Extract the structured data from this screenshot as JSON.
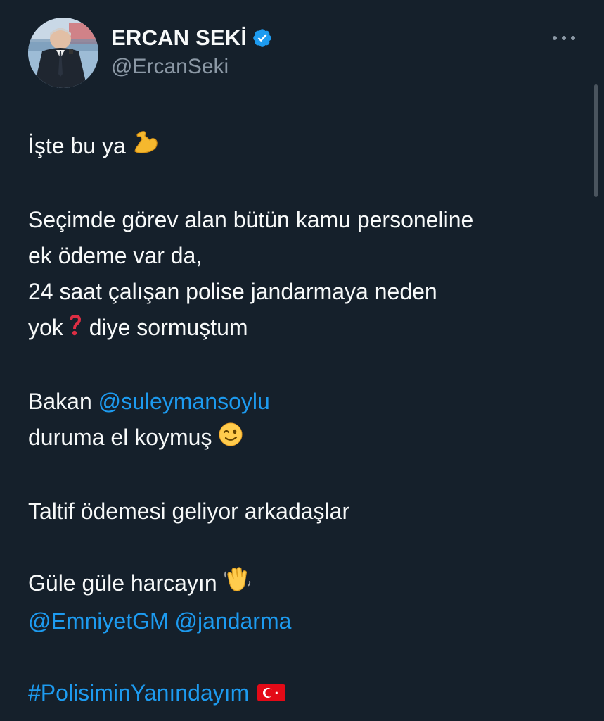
{
  "author": {
    "display_name": "ERCAN SEKİ",
    "handle": "@ErcanSeki",
    "verified": true
  },
  "tweet": {
    "line1_text": "İşte bu ya ",
    "line2": "Seçimde görev alan bütün kamu personeline",
    "line3": "ek ödeme var da,",
    "line4": "24 saat çalışan polise jandarmaya neden",
    "line5_before": "yok",
    "line5_after": " diye sormuştum",
    "line6_text": "Bakan ",
    "mention1": "@suleymansoylu",
    "line7_text": "duruma el koymuş ",
    "line8": "Taltif ödemesi geliyor arkadaşlar",
    "line9_text": "Güle güle harcayın ",
    "mention2": "@EmniyetGM",
    "mention3": "@jandarma",
    "hashtag": "#PolisiminYanındayım"
  },
  "icons": {
    "more": "more-options-icon",
    "verified": "verified-badge-icon",
    "emoji_muscle": "flexed-biceps-emoji",
    "emoji_question": "red-question-mark-emoji",
    "emoji_wink": "winking-face-emoji",
    "emoji_wave": "waving-hand-emoji",
    "emoji_flag": "turkey-flag-emoji"
  },
  "colors": {
    "background": "#15202b",
    "text": "#f7f9f9",
    "secondary_text": "#8b98a5",
    "link": "#1d9bf0",
    "verified": "#1d9bf0"
  }
}
